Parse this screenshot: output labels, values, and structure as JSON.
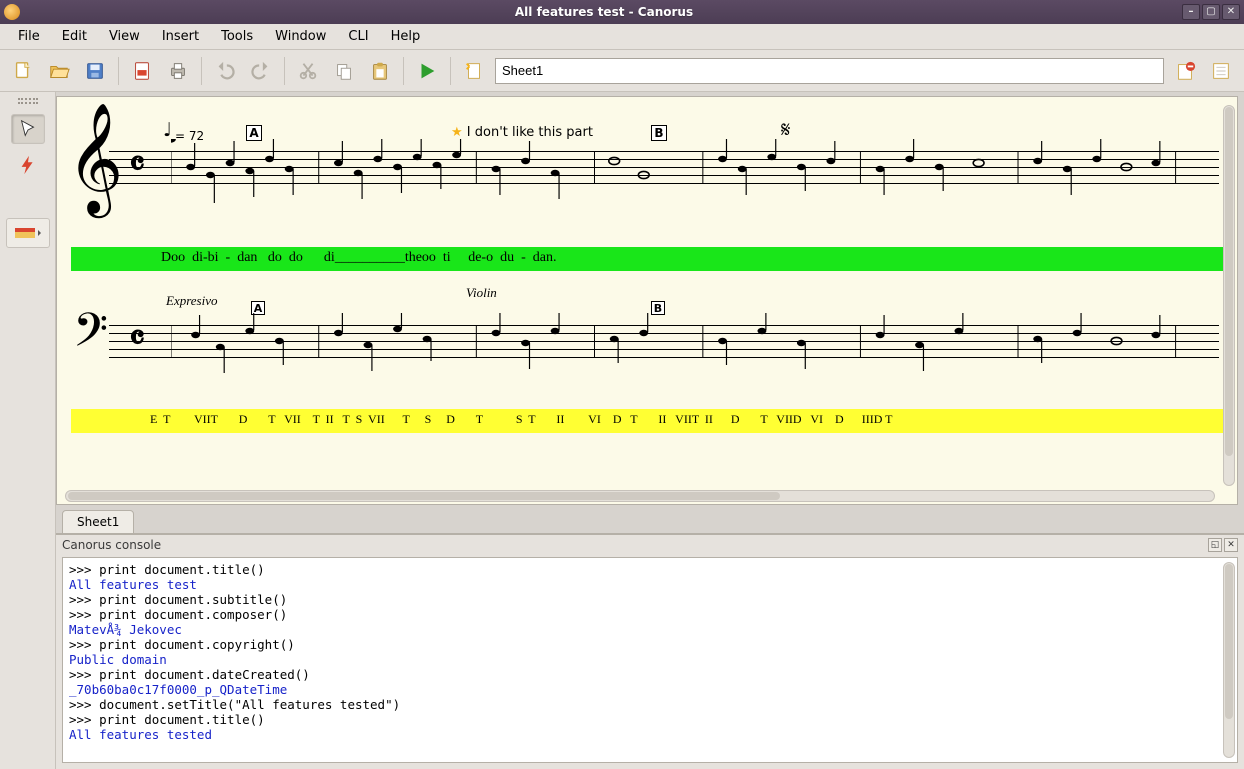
{
  "window": {
    "title": "All features test - Canorus"
  },
  "menus": [
    "File",
    "Edit",
    "View",
    "Insert",
    "Tools",
    "Window",
    "CLI",
    "Help"
  ],
  "toolbar": {
    "sheet_field_value": "Sheet1"
  },
  "sheet_tabs": [
    "Sheet1"
  ],
  "score": {
    "tempo_text": "= 72",
    "rehearsal_marks_top": [
      "A",
      "B"
    ],
    "rehearsal_marks_bottom": [
      "A",
      "B"
    ],
    "annotation_text": "I don't like this part",
    "expression_text": "Expresivo",
    "instrument_hint": "Violin",
    "lyrics_green": "Doo  di-bi  -  dan   do  do      di__________theoo  ti     de-o  du  -  dan.",
    "lyrics_yellow": "   E  T        VIIT       D       T   VII    T  II   T  S  VII      T     S     D       T           S  T       II        VI    D   T       II   VIIT  II      D       T   VIID   VI    D      IIID T"
  },
  "console": {
    "title": "Canorus console",
    "lines": [
      {
        "cls": "in",
        "text": ">>> print document.title()"
      },
      {
        "cls": "out",
        "text": "All features test"
      },
      {
        "cls": "in",
        "text": ">>> print document.subtitle()"
      },
      {
        "cls": "out",
        "text": ""
      },
      {
        "cls": "in",
        "text": ">>> print document.composer()"
      },
      {
        "cls": "out",
        "text": "MatevÅ¾ Jekovec"
      },
      {
        "cls": "in",
        "text": ">>> print document.copyright()"
      },
      {
        "cls": "out",
        "text": "Public domain"
      },
      {
        "cls": "in",
        "text": ">>> print document.dateCreated()"
      },
      {
        "cls": "out",
        "text": "_70b60ba0c17f0000_p_QDateTime"
      },
      {
        "cls": "in",
        "text": ">>> document.setTitle(\"All features tested\")"
      },
      {
        "cls": "in",
        "text": ">>> print document.title()"
      },
      {
        "cls": "out",
        "text": "All features tested"
      }
    ]
  }
}
